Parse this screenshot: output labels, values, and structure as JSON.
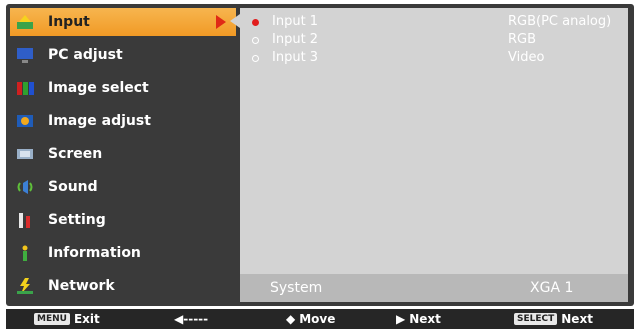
{
  "menu": {
    "items": [
      {
        "label": "Input",
        "icon": "input-icon",
        "active": true
      },
      {
        "label": "PC adjust",
        "icon": "pc-adjust-icon"
      },
      {
        "label": "Image select",
        "icon": "image-select-icon"
      },
      {
        "label": "Image adjust",
        "icon": "image-adjust-icon"
      },
      {
        "label": "Screen",
        "icon": "screen-icon"
      },
      {
        "label": "Sound",
        "icon": "sound-icon"
      },
      {
        "label": "Setting",
        "icon": "setting-icon"
      },
      {
        "label": "Information",
        "icon": "information-icon"
      },
      {
        "label": "Network",
        "icon": "network-icon"
      }
    ]
  },
  "inputs": [
    {
      "name": "Input 1",
      "type": "RGB(PC analog)",
      "selected": true
    },
    {
      "name": "Input 2",
      "type": "RGB",
      "selected": false
    },
    {
      "name": "Input 3",
      "type": "Video",
      "selected": false
    }
  ],
  "system": {
    "label": "System",
    "value": "XGA 1"
  },
  "footer": {
    "menu_key": "MENU",
    "exit": "Exit",
    "back_arrow": "◀-----",
    "move": "Move",
    "next": "Next",
    "select_key": "SELECT",
    "select_next": "Next"
  },
  "colors": {
    "accent": "#f19a25",
    "panel": "#d3d3d3",
    "frame": "#3a3a3a",
    "marker": "#e11c1c"
  }
}
